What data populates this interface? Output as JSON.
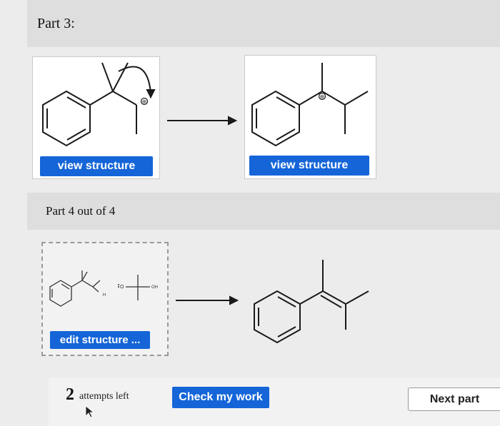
{
  "part3": {
    "title": "Part 3:"
  },
  "reactant": {
    "button_label": "view structure"
  },
  "product": {
    "button_label": "view structure"
  },
  "part4": {
    "title": "Part 4 out of 4"
  },
  "edit": {
    "button_label": "edit structure ...",
    "labels": {
      "o_label": "O",
      "oh_label": "OH",
      "h_label": "H"
    }
  },
  "charges": {
    "plus": "⊕"
  },
  "footer": {
    "attempts_count": "2",
    "attempts_text": "attempts left",
    "check_label": "Check my work",
    "next_label": "Next part"
  },
  "colors": {
    "accent": "#1565d8",
    "background": "#ececec",
    "header": "#dedede"
  },
  "icons": [
    "reaction-arrow-icon",
    "curved-arrow-icon",
    "mouse-cursor-icon"
  ]
}
